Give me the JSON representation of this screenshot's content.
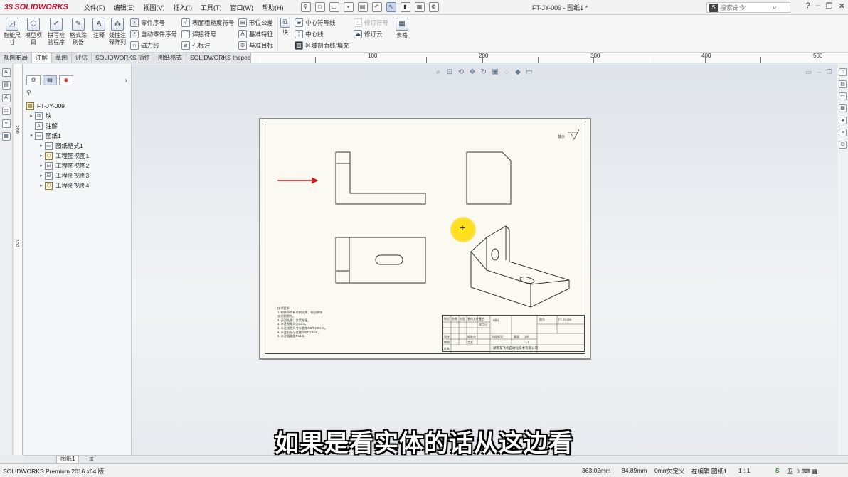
{
  "app": {
    "logo": "SOLIDWORKS",
    "logo_mark": "3S",
    "doc_title": "FT-JY-009 - 图纸1 *",
    "search_placeholder": "搜索命令",
    "search_icon_label": "S"
  },
  "menus": [
    "文件(F)",
    "编辑(E)",
    "视图(V)",
    "插入(I)",
    "工具(T)",
    "窗口(W)",
    "帮助(H)"
  ],
  "ribbon": {
    "smart_dim": "智能尺寸",
    "big_small": [
      "模型项目",
      "拼写检验程序",
      "格式涂刷器",
      "注释",
      "线性注释阵列"
    ],
    "col1": [
      "零件序号",
      "自动零件序号",
      "磁力线"
    ],
    "col2": [
      "表面粗糙度符号",
      "焊接符号",
      "孔标注"
    ],
    "col3": [
      "形位公差",
      "基准特征",
      "基准目标"
    ],
    "col4_block": "块",
    "col4": [
      "中心符号线",
      "中心线",
      "区域剖面线/填充"
    ],
    "col5": [
      "修订符号",
      "修订云"
    ],
    "table": "表格"
  },
  "tabs": [
    "视图布局",
    "注解",
    "草图",
    "评估",
    "SOLIDWORKS 插件",
    "图纸格式",
    "SOLIDWORKS Inspection"
  ],
  "active_tab": "注解",
  "ruler_labels": [
    "100",
    "200",
    "300",
    "400",
    "500"
  ],
  "vruler_labels": [
    "200",
    "100"
  ],
  "tree": {
    "root": "FT-JY-009",
    "items": [
      {
        "label": "块",
        "level": 1,
        "expander": "▸"
      },
      {
        "label": "注解",
        "level": 1,
        "expander": ""
      },
      {
        "label": "图纸1",
        "level": 1,
        "expander": "▾"
      },
      {
        "label": "图纸格式1",
        "level": 2,
        "expander": "▸"
      },
      {
        "label": "工程图视图1",
        "level": 2,
        "expander": "▸"
      },
      {
        "label": "工程图视图2",
        "level": 2,
        "expander": "▸"
      },
      {
        "label": "工程图视图3",
        "level": 2,
        "expander": "▸"
      },
      {
        "label": "工程图视图4",
        "level": 2,
        "expander": "▸"
      }
    ]
  },
  "drawing": {
    "notes": [
      "技术要求",
      "1. 制件不得有毛刺尖角，锐边倒钝",
      "   去毛刺倒钝。",
      "2. 表面处理：发黑处理。",
      "3. 未注倒角均为C0.5。",
      "4. 未注线性尺寸公差按GB/T1804-m。",
      "5. 未注形位公差按GB/T1184-K。",
      "6. 未注粗糙度Ra3.2。"
    ],
    "rough_symbol": "其余",
    "title_block": {
      "cells": [
        "标记",
        "处数",
        "分区",
        "更改文件号",
        "签名",
        "年月日",
        "设计",
        "标准化",
        "审核",
        "工艺",
        "批准",
        "阶段标记",
        "重量",
        "比例",
        "材料",
        "图号",
        "FT-JY-009",
        "1:1"
      ],
      "company": "湖南某飞机自动化技术有限公司"
    }
  },
  "sheet_tab": "图纸1",
  "status": {
    "product": "SOLIDWORKS Premium 2016 x64 版",
    "x": "363.02mm",
    "y": "84.89mm",
    "z": "0mm",
    "defined": "欠定义",
    "editing": "在编辑 图纸1",
    "scale": "1 : 1"
  },
  "subtitle": "如果是看实体的话从这边看"
}
